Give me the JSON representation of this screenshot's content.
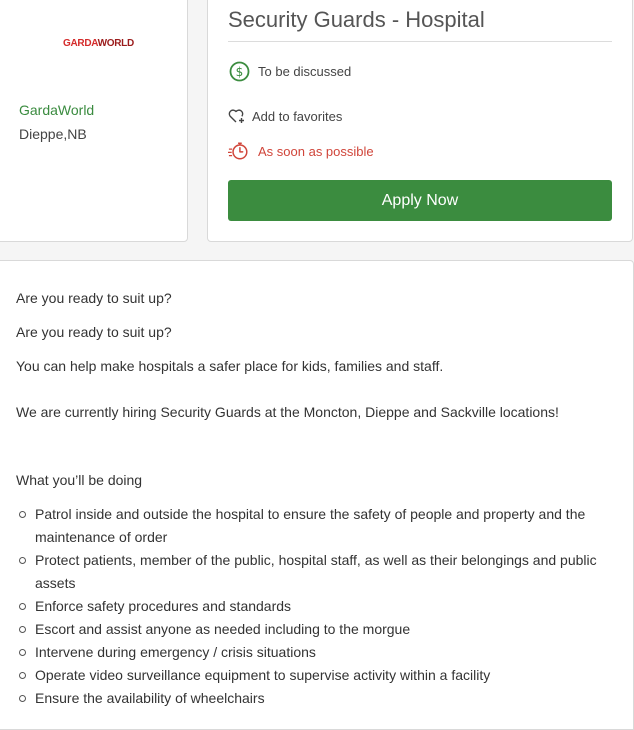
{
  "company": {
    "logo_text": "GARDAWORLD",
    "name": "GardaWorld",
    "location": "Dieppe,NB"
  },
  "job": {
    "title": "Security Guards - Hospital",
    "salary": "To be discussed",
    "favorites_label": "Add to favorites",
    "start": "As soon as possible",
    "apply_label": "Apply Now"
  },
  "colors": {
    "accent_green": "#3b8c3f",
    "urgent_red": "#d0453a",
    "logo_red": "#d42b2b"
  },
  "description": {
    "p1": "Are you ready to suit up?",
    "p2": "Are you ready to suit up?",
    "p3": "You can help make hospitals a safer place for kids, families and staff.",
    "p4": "We are currently hiring Security Guards at the Moncton, Dieppe and Sackville locations!",
    "section_heading": "What you’ll be doing",
    "duties": [
      "Patrol inside and outside the hospital to ensure the safety of people and property and the maintenance of order",
      "Protect patients, member of the public, hospital staff, as well as their belongings and public assets",
      "Enforce safety procedures and standards",
      "Escort and assist anyone as needed including to the morgue",
      "Intervene during emergency / crisis situations",
      "Operate video surveillance equipment to supervise activity within a facility",
      "Ensure the availability of wheelchairs"
    ]
  }
}
